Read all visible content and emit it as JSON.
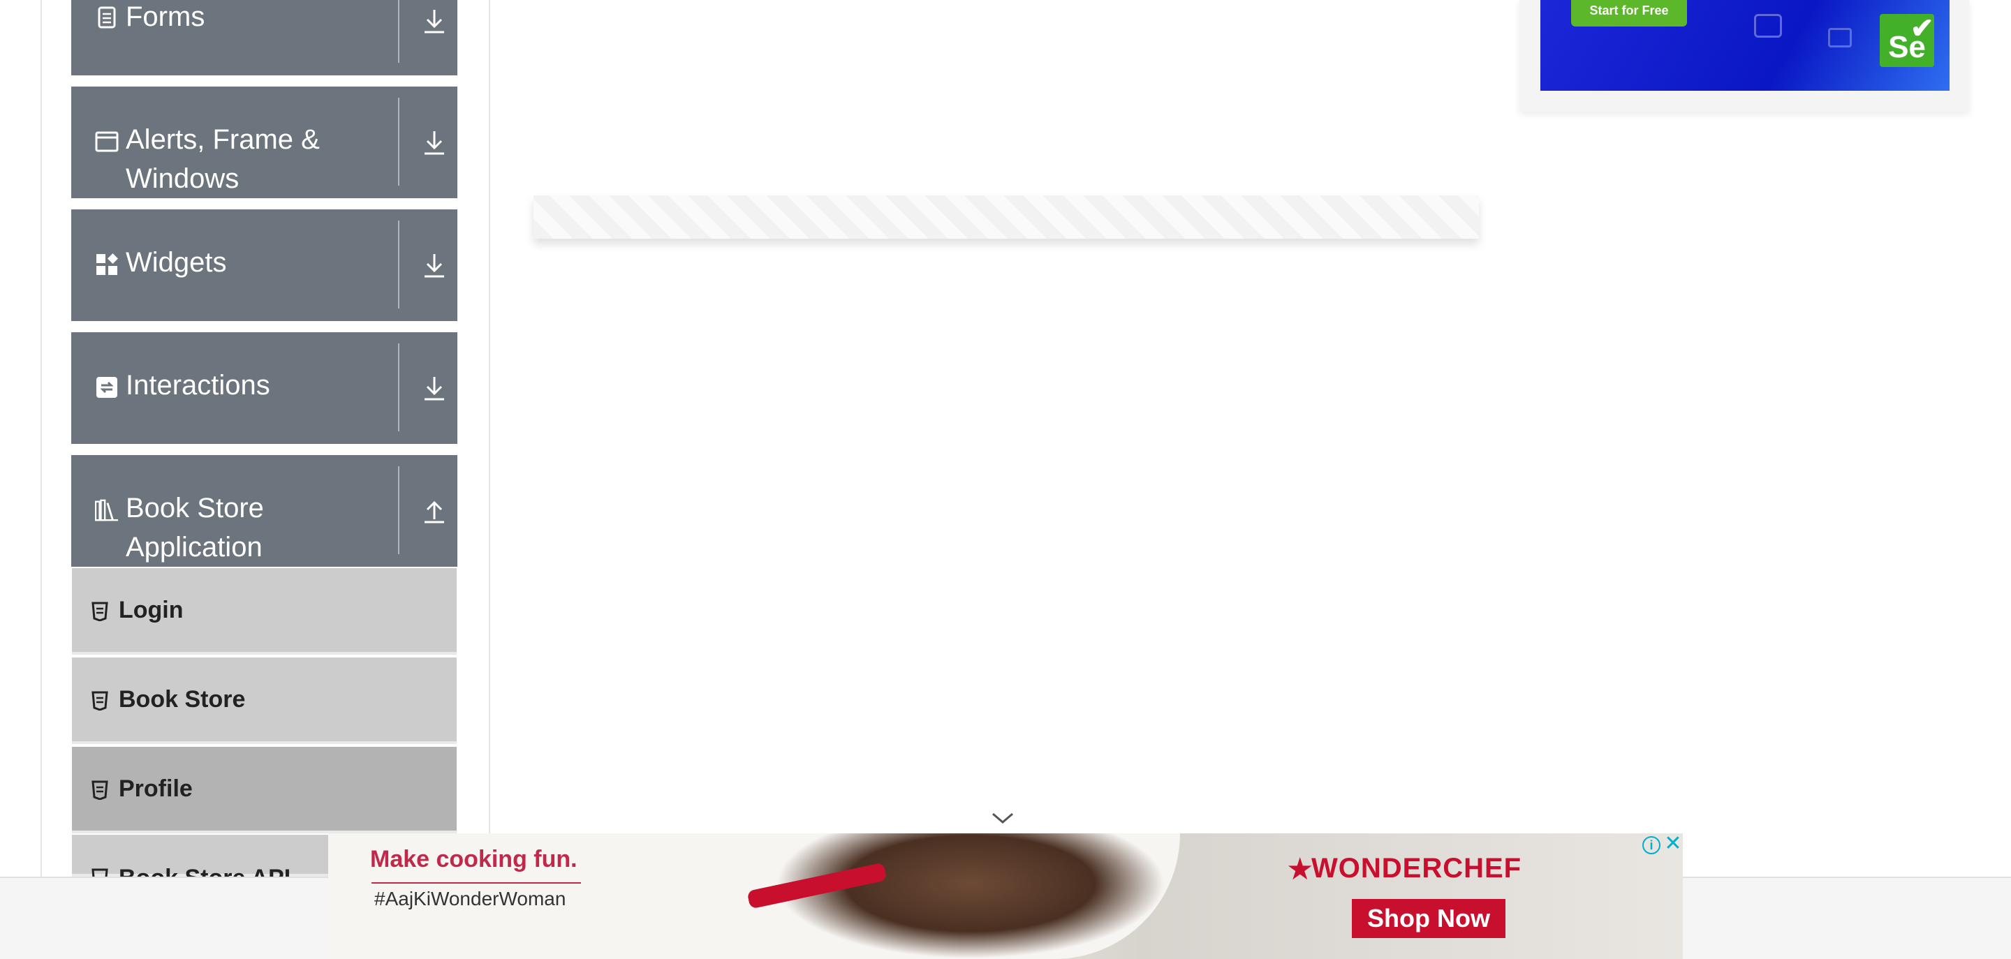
{
  "sidebar": {
    "groups": [
      {
        "label": "Forms",
        "icon": "document-icon",
        "arrow": "download-arrow-icon"
      },
      {
        "label": "Alerts, Frame & Windows",
        "icon": "window-icon",
        "arrow": "download-arrow-icon"
      },
      {
        "label": "Widgets",
        "icon": "widgets-icon",
        "arrow": "download-arrow-icon"
      },
      {
        "label": "Interactions",
        "icon": "interactions-icon",
        "arrow": "download-arrow-icon"
      },
      {
        "label": "Book Store Application",
        "icon": "library-icon",
        "arrow": "upload-arrow-icon",
        "expanded": true
      }
    ],
    "items": [
      {
        "label": "Login",
        "icon": "html5-icon"
      },
      {
        "label": "Book Store",
        "icon": "html5-icon"
      },
      {
        "label": "Profile",
        "icon": "html5-icon",
        "active": true
      },
      {
        "label": "Book Store API",
        "icon": "html5-icon"
      }
    ]
  },
  "ads": {
    "top": {
      "button": "Start for Free",
      "badge": "Se"
    },
    "bottom": {
      "headline": "Make cooking fun.",
      "hashtag": "#AajKiWonderWoman",
      "brand": "WONDERCHEF",
      "cta": "Shop Now"
    }
  },
  "colors": {
    "group_bg": "#6c757d",
    "item_bg": "#cccccc",
    "item_active_bg": "#b3b3b3",
    "brand_red": "#c8102e"
  }
}
